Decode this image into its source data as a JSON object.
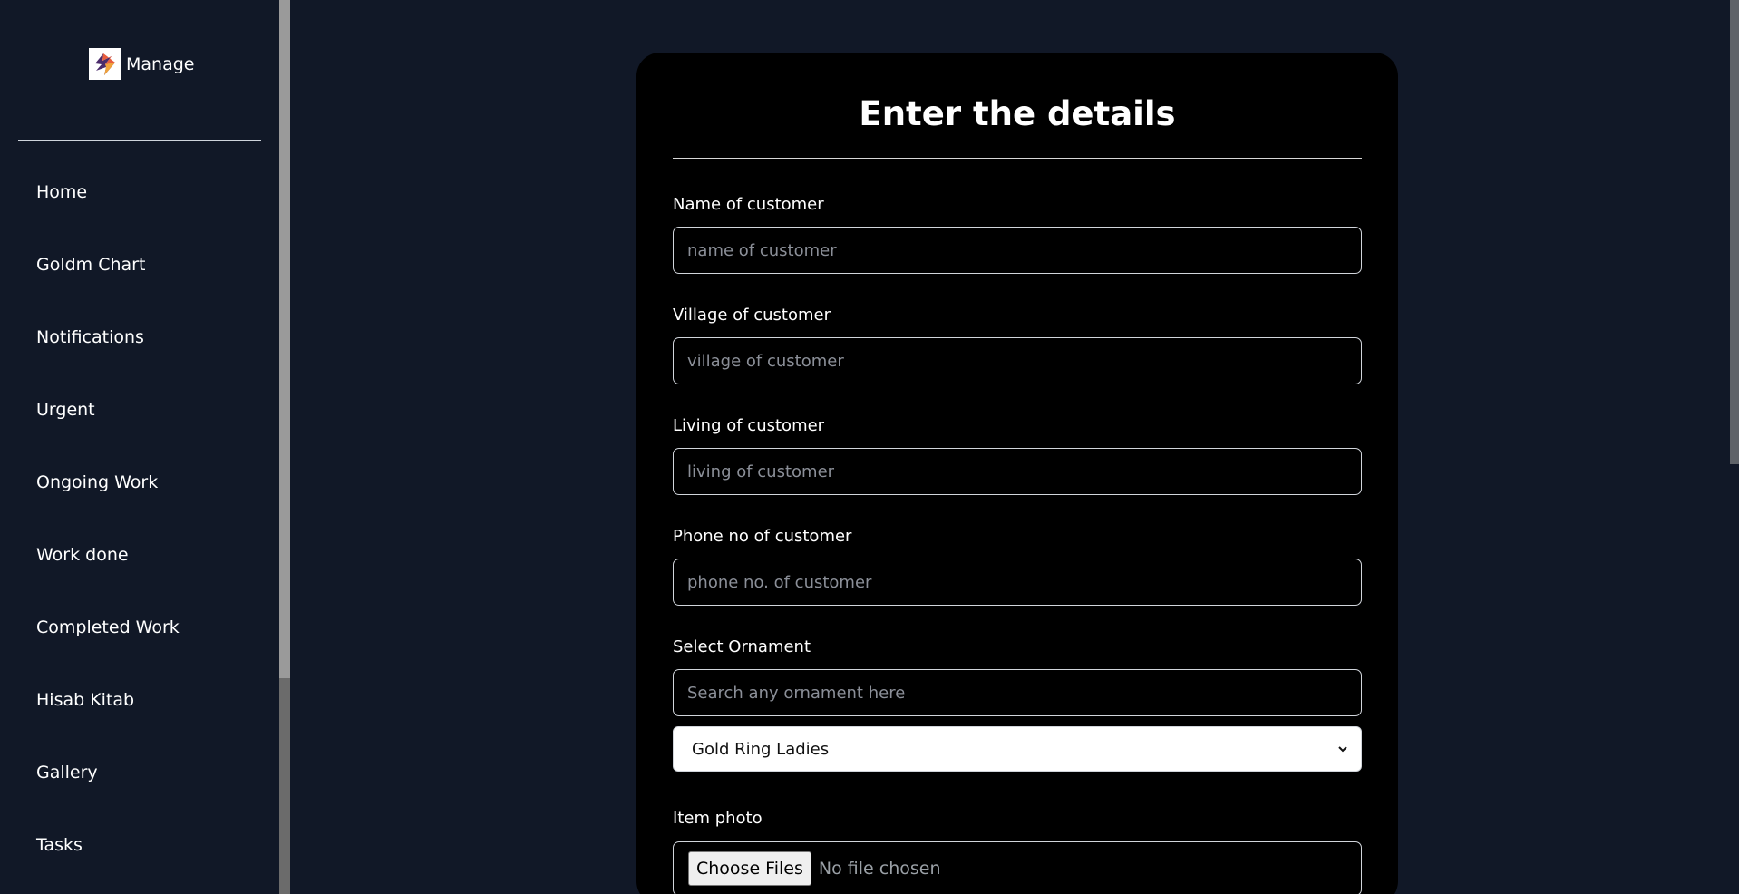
{
  "brand": {
    "name": "Manage"
  },
  "sidebar": {
    "items": [
      {
        "label": "Home"
      },
      {
        "label": "Goldm Chart"
      },
      {
        "label": "Notifications"
      },
      {
        "label": "Urgent"
      },
      {
        "label": "Ongoing Work"
      },
      {
        "label": "Work done"
      },
      {
        "label": "Completed Work"
      },
      {
        "label": "Hisab Kitab"
      },
      {
        "label": "Gallery"
      },
      {
        "label": "Tasks"
      }
    ]
  },
  "form": {
    "title": "Enter the details",
    "name": {
      "label": "Name of customer",
      "placeholder": "name of customer",
      "value": ""
    },
    "village": {
      "label": "Village of customer",
      "placeholder": "village of customer",
      "value": ""
    },
    "living": {
      "label": "Living of customer",
      "placeholder": "living of customer",
      "value": ""
    },
    "phone": {
      "label": "Phone no of customer",
      "placeholder": "phone no. of customer",
      "value": ""
    },
    "ornament": {
      "label": "Select Ornament",
      "search_placeholder": "Search any ornament here",
      "selected": "Gold Ring Ladies"
    },
    "photo": {
      "label": "Item photo",
      "button_label": "Choose Files",
      "status": "No file chosen"
    }
  },
  "icons": {
    "logo": "manage-logo-icon",
    "chevron": "chevron-down-icon"
  }
}
